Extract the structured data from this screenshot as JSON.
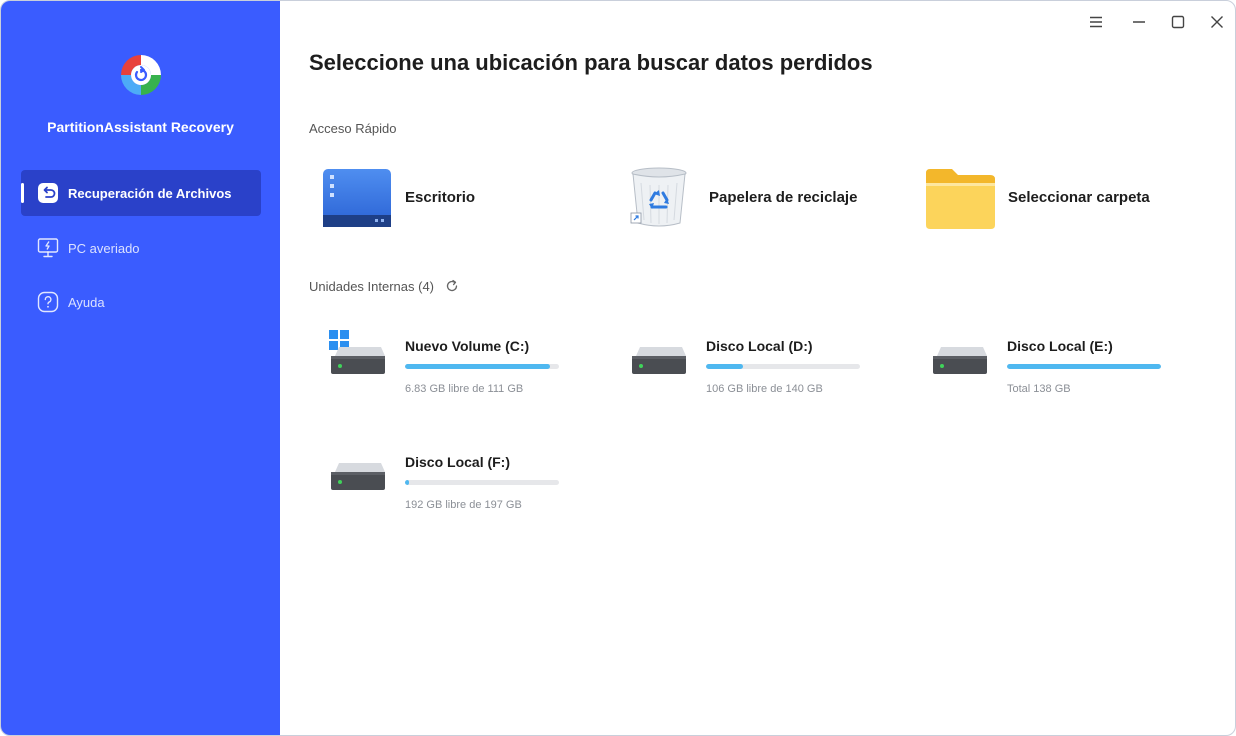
{
  "app": {
    "name": "PartitionAssistant Recovery"
  },
  "sidebar": {
    "items": [
      {
        "label": "Recuperación de Archivos",
        "icon": "file-recovery-icon",
        "active": true
      },
      {
        "label": "PC averiado",
        "icon": "monitor-bolt-icon",
        "active": false
      },
      {
        "label": "Ayuda",
        "icon": "help-icon",
        "active": false
      }
    ]
  },
  "main": {
    "title": "Seleccione una ubicación para buscar datos perdidos",
    "quick_access": {
      "label": "Acceso Rápido",
      "items": [
        {
          "label": "Escritorio",
          "icon": "desktop-icon"
        },
        {
          "label": "Papelera de reciclaje",
          "icon": "recycle-bin-icon"
        },
        {
          "label": "Seleccionar carpeta",
          "icon": "folder-icon"
        }
      ]
    },
    "internal_drives": {
      "label": "Unidades Internas (4)",
      "drives": [
        {
          "name": "Nuevo Volume (C:)",
          "info": "6.83 GB libre de 111 GB",
          "used_fraction": 0.94,
          "system": true
        },
        {
          "name": "Disco Local (D:)",
          "info": "106 GB libre de 140 GB",
          "used_fraction": 0.24,
          "system": false
        },
        {
          "name": "Disco Local (E:)",
          "info": "Total 138 GB",
          "used_fraction": 1.0,
          "system": false
        },
        {
          "name": "Disco Local (F:)",
          "info": "192 GB libre de 197 GB",
          "used_fraction": 0.025,
          "system": false
        }
      ]
    }
  },
  "colors": {
    "sidebar_bg": "#3a5cff",
    "sidebar_active": "#2a41c9",
    "progress_fill": "#4fb8f0",
    "progress_track": "#e6e7ea"
  }
}
